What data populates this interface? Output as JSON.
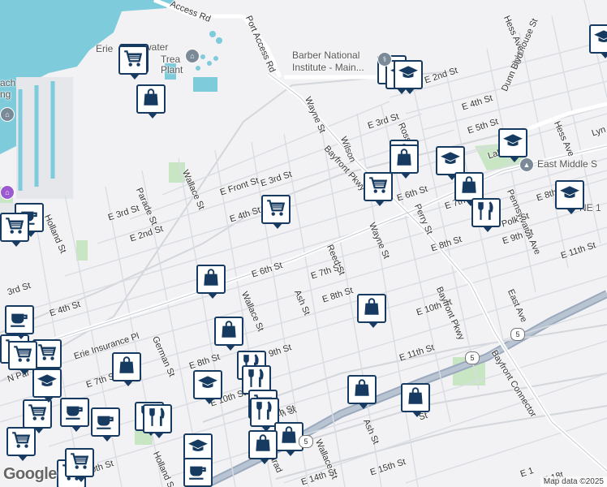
{
  "map": {
    "attribution": "Map data ©2025",
    "logo": "Google",
    "colors": {
      "water": "#7ecbdc",
      "land": "#f2f2f4",
      "park": "#c8e6c4",
      "road": "#ffffff",
      "highway": "#9aa9bd",
      "pin_border": "#173b60"
    },
    "poi_labels": [
      "Erie",
      "water",
      "Trea",
      "Plant",
      "Barber National",
      "Institute - Main...",
      "East Middle S",
      "ach",
      "ng",
      "NE 1"
    ],
    "street_labels": [
      "Access Rd",
      "Port Access Rd",
      "Wayne St",
      "Bayfront Pkwy",
      "Wilson",
      "Ross St",
      "E 3rd St",
      "E 2nd St",
      "E 4th St",
      "E 5th St",
      "Lighthouse St",
      "Dunn Blvd",
      "Hess Ave",
      "Hess Ave",
      "Lake R",
      "Lyn",
      "Pennsylvania Ave",
      "E 8th",
      "E 7th",
      "Polk St",
      "E 9th St",
      "E 11th St",
      "Perry St",
      "Wallace St",
      "E Front St",
      "Parade St",
      "E 3rd St",
      "E 2nd St",
      "Holland St",
      "E 3rd St",
      "E 4th St",
      "E 6th St",
      "E 6th St",
      "E 7th St",
      "Reed St",
      "Wayne St",
      "E 8th St",
      "E 8th St",
      "Ash St",
      "Wallace St",
      "German St",
      "E 4th St",
      "3rd St",
      "Erie Insurance Pl",
      "N Par",
      "E 7th St",
      "E 8th St",
      "9th St",
      "E 10th St",
      "E 11th St",
      "Bayfront Pkwy",
      "East Ave",
      "Bayfront Connector",
      "Ash St",
      "St",
      "E 10th St",
      "Holland S",
      "Parad",
      "Wallace St",
      "E 14th St",
      "E 15th St",
      "h St",
      "E 10th St",
      "th St",
      "E 1",
      "E 18t"
    ],
    "route_shields": [
      "5",
      "5",
      "5"
    ],
    "pins": [
      "shopping-cart",
      "shopping-cart",
      "shopping-bag",
      "graduation-cap",
      "graduation-cap",
      "graduation-cap",
      "shopping-bag",
      "shopping-bag",
      "shopping-cart",
      "graduation-cap",
      "graduation-cap",
      "shopping-bag",
      "restaurant",
      "graduation-cap",
      "shopping-cart",
      "coffee",
      "shopping-bag",
      "shopping-bag",
      "shopping-bag",
      "graduation-cap",
      "restaurant",
      "restaurant",
      "shopping-bag",
      "shopping-bag",
      "shopping-cart",
      "restaurant",
      "restaurant",
      "shopping-bag",
      "graduation-cap",
      "shopping-bag",
      "shopping-bag",
      "coffee",
      "coffee",
      "coffee",
      "shopping-cart",
      "shopping-cart",
      "shopping-cart",
      "shopping-cart",
      "shopping-cart",
      "graduation-cap",
      "restaurant",
      "graduation-cap",
      "coffee",
      "shopping-cart",
      "shopping-cart",
      "shopping-cart"
    ]
  }
}
